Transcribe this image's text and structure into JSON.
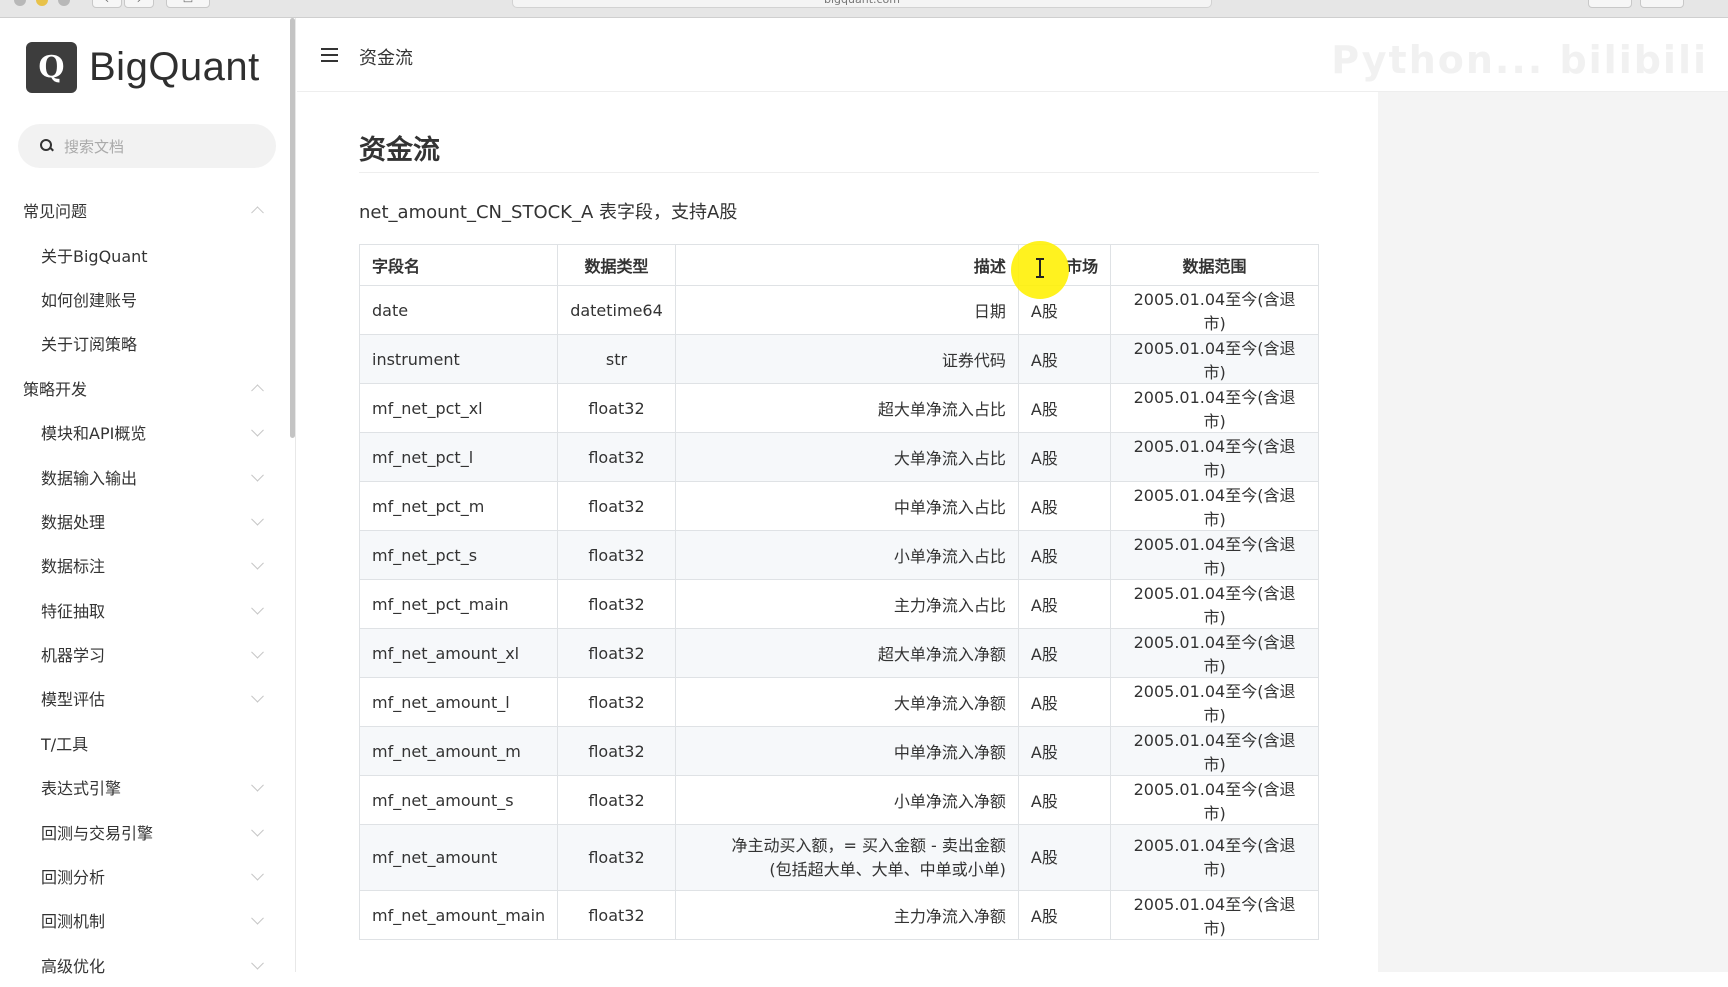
{
  "browser": {
    "url": "bigquant.com"
  },
  "sidebar": {
    "brand": {
      "mark": "Q",
      "name": "BigQuant"
    },
    "search_placeholder": "搜索文档",
    "items": [
      {
        "label": "常见问题",
        "level": "group",
        "expanded": true
      },
      {
        "label": "关于BigQuant",
        "level": "sub"
      },
      {
        "label": "如何创建账号",
        "level": "sub"
      },
      {
        "label": "关于订阅策略",
        "level": "sub"
      },
      {
        "label": "策略开发",
        "level": "group",
        "expanded": true
      },
      {
        "label": "模块和API概览",
        "level": "sub",
        "expandable": true
      },
      {
        "label": "数据输入输出",
        "level": "sub",
        "expandable": true
      },
      {
        "label": "数据处理",
        "level": "sub",
        "expandable": true
      },
      {
        "label": "数据标注",
        "level": "sub",
        "expandable": true
      },
      {
        "label": "特征抽取",
        "level": "sub",
        "expandable": true
      },
      {
        "label": "机器学习",
        "level": "sub",
        "expandable": true
      },
      {
        "label": "模型评估",
        "level": "sub",
        "expandable": true
      },
      {
        "label": "T/工具",
        "level": "sub"
      },
      {
        "label": "表达式引擎",
        "level": "sub",
        "expandable": true
      },
      {
        "label": "回测与交易引擎",
        "level": "sub",
        "expandable": true
      },
      {
        "label": "回测分析",
        "level": "sub",
        "expandable": true
      },
      {
        "label": "回测机制",
        "level": "sub",
        "expandable": true
      },
      {
        "label": "高级优化",
        "level": "sub",
        "expandable": true
      }
    ]
  },
  "header": {
    "title": "资金流",
    "watermark": "Python... bilibili"
  },
  "main": {
    "title": "资金流",
    "intro": "net_amount_CN_STOCK_A 表字段，支持A股",
    "table": {
      "headers": [
        "字段名",
        "数据类型",
        "描述",
        "市场",
        "数据范围"
      ],
      "rows": [
        [
          "date",
          "datetime64",
          "日期",
          "A股",
          "2005.01.04至今(含退市)"
        ],
        [
          "instrument",
          "str",
          "证券代码",
          "A股",
          "2005.01.04至今(含退市)"
        ],
        [
          "mf_net_pct_xl",
          "float32",
          "超大单净流入占比",
          "A股",
          "2005.01.04至今(含退市)"
        ],
        [
          "mf_net_pct_l",
          "float32",
          "大单净流入占比",
          "A股",
          "2005.01.04至今(含退市)"
        ],
        [
          "mf_net_pct_m",
          "float32",
          "中单净流入占比",
          "A股",
          "2005.01.04至今(含退市)"
        ],
        [
          "mf_net_pct_s",
          "float32",
          "小单净流入占比",
          "A股",
          "2005.01.04至今(含退市)"
        ],
        [
          "mf_net_pct_main",
          "float32",
          "主力净流入占比",
          "A股",
          "2005.01.04至今(含退市)"
        ],
        [
          "mf_net_amount_xl",
          "float32",
          "超大单净流入净额",
          "A股",
          "2005.01.04至今(含退市)"
        ],
        [
          "mf_net_amount_l",
          "float32",
          "大单净流入净额",
          "A股",
          "2005.01.04至今(含退市)"
        ],
        [
          "mf_net_amount_m",
          "float32",
          "中单净流入净额",
          "A股",
          "2005.01.04至今(含退市)"
        ],
        [
          "mf_net_amount_s",
          "float32",
          "小单净流入净额",
          "A股",
          "2005.01.04至今(含退市)"
        ],
        [
          "mf_net_amount",
          "float32",
          "净主动买入额，= 买入金额 - 卖出金额\n(包括超大单、大单、中单或小单)",
          "A股",
          "2005.01.04至今(含退市)"
        ],
        [
          "mf_net_amount_main",
          "float32",
          "主力净流入净额",
          "A股",
          "2005.01.04至今(含退市)"
        ]
      ]
    }
  }
}
